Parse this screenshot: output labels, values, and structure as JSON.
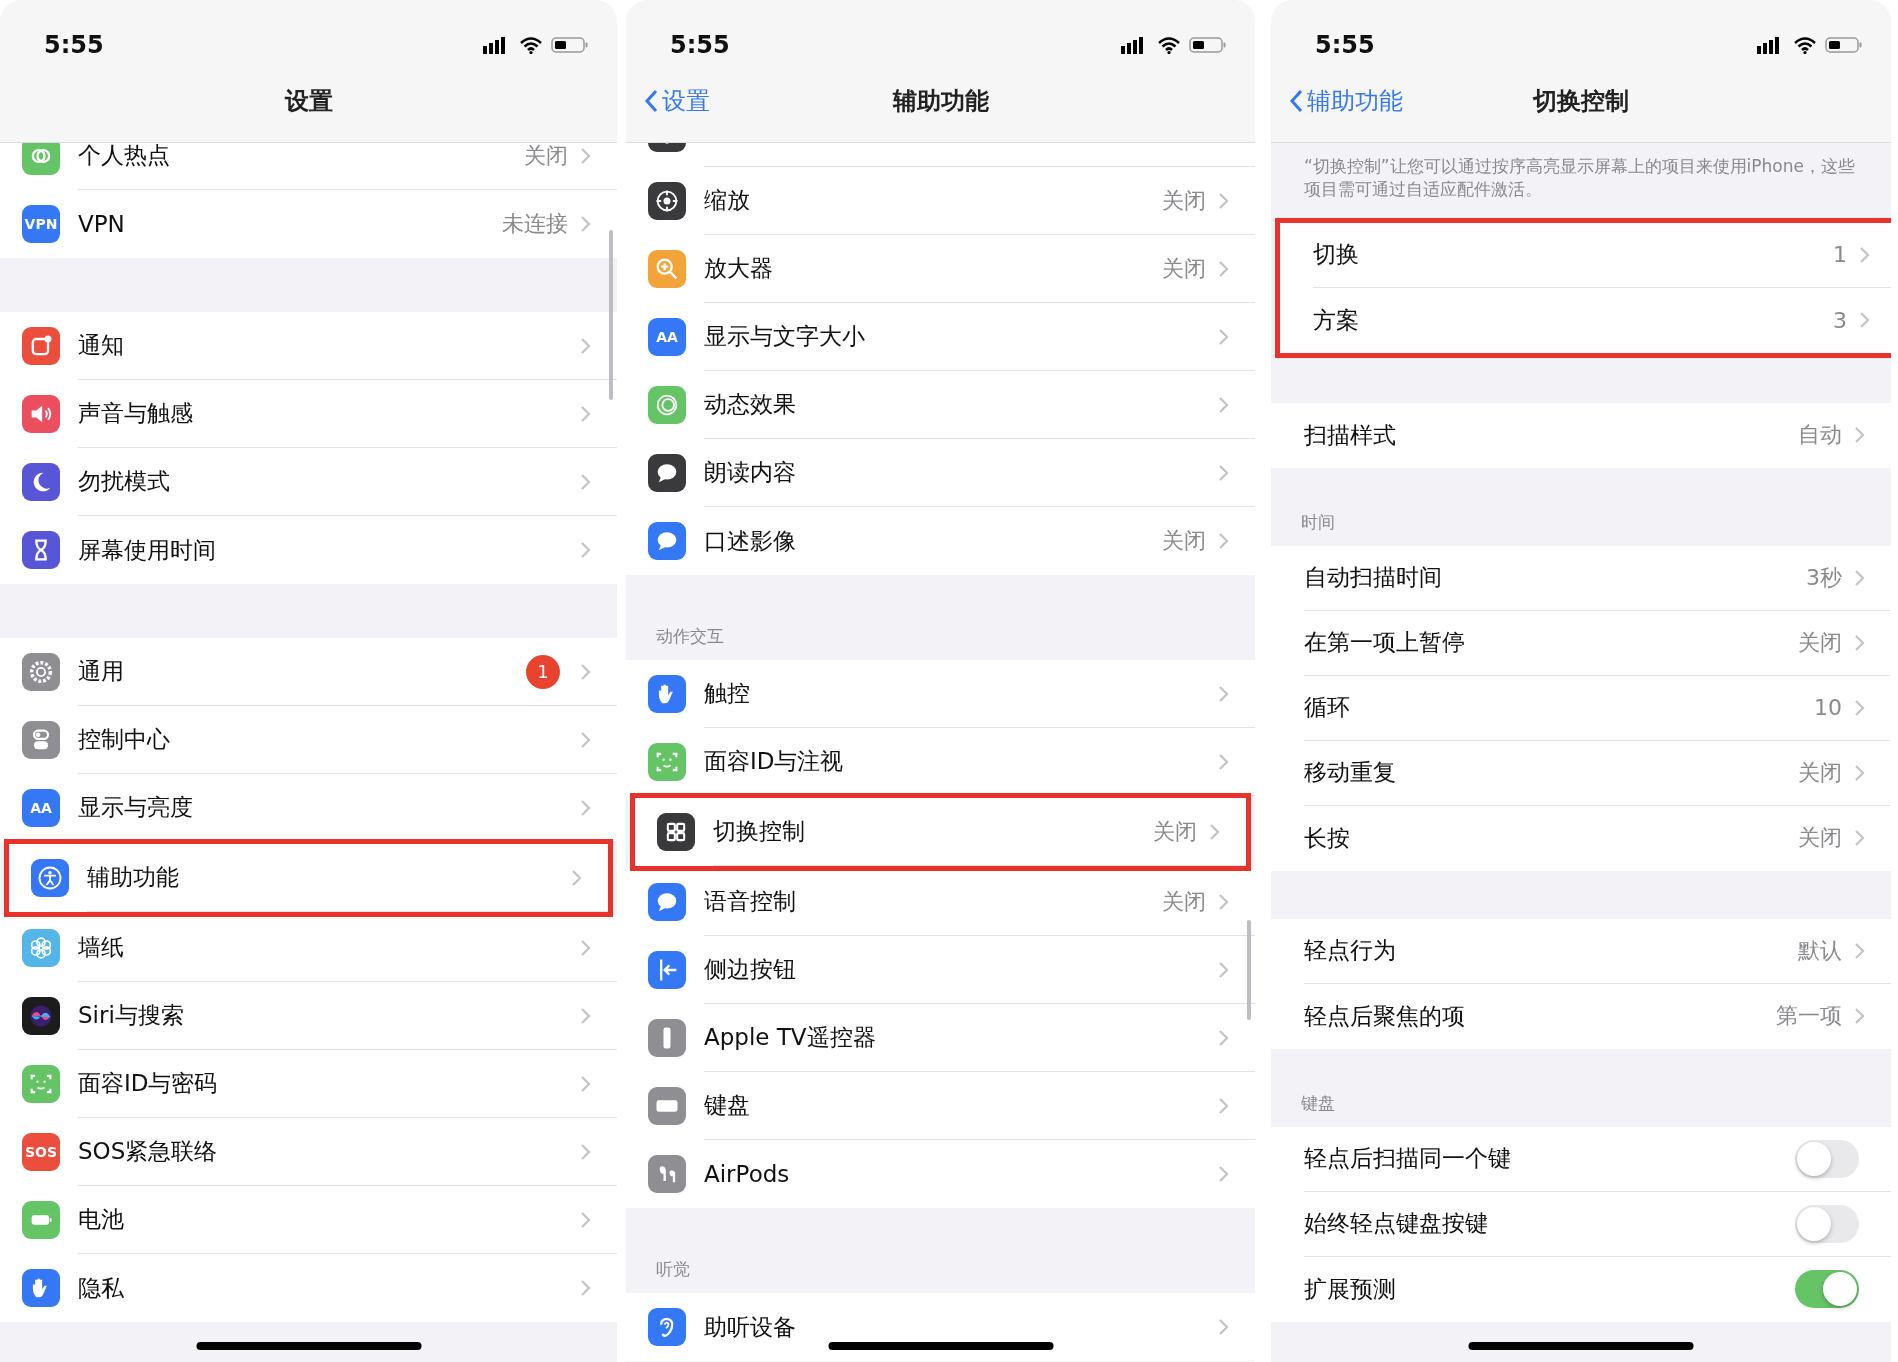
{
  "panels": [
    {
      "time": "5:55",
      "nav": {
        "title": "设置"
      },
      "sections": [
        {
          "rows": [
            {
              "label": "个人热点",
              "value": "关闭",
              "color": "#65c466",
              "kind": "link",
              "highlighted": false
            },
            {
              "label": "VPN",
              "value": "未连接",
              "color": "#3478f6",
              "icon_text": "VPN",
              "kind": "link",
              "highlighted": false
            }
          ]
        },
        {
          "rows": [
            {
              "label": "通知",
              "color": "#eb4e3d",
              "kind": "link",
              "highlighted": false
            },
            {
              "label": "声音与触感",
              "color": "#eb4e5f",
              "kind": "link",
              "highlighted": false
            },
            {
              "label": "勿扰模式",
              "color": "#5856d6",
              "kind": "link",
              "highlighted": false
            },
            {
              "label": "屏幕使用时间",
              "color": "#5856d6",
              "kind": "link",
              "highlighted": false
            }
          ]
        },
        {
          "rows": [
            {
              "label": "通用",
              "badge": "1",
              "color": "#8e8e93",
              "kind": "link",
              "highlighted": false
            },
            {
              "label": "控制中心",
              "color": "#8e8e93",
              "kind": "link",
              "highlighted": false
            },
            {
              "label": "显示与亮度",
              "color": "#3478f6",
              "icon_text": "AA",
              "kind": "link",
              "highlighted": false
            },
            {
              "label": "辅助功能",
              "color": "#3478f6",
              "kind": "link",
              "highlighted": true
            },
            {
              "label": "墙纸",
              "color": "#54b5e8",
              "kind": "link",
              "highlighted": false
            },
            {
              "label": "Siri与搜索",
              "color": "#1c1c1e",
              "kind": "link",
              "highlighted": false
            },
            {
              "label": "面容ID与密码",
              "color": "#65c466",
              "kind": "link",
              "highlighted": false
            },
            {
              "label": "SOS紧急联络",
              "color": "#eb4e3d",
              "icon_text": "SOS",
              "kind": "link",
              "highlighted": false
            },
            {
              "label": "电池",
              "color": "#65c466",
              "kind": "link",
              "highlighted": false
            },
            {
              "label": "隐私",
              "color": "#3478f6",
              "kind": "link",
              "highlighted": false
            }
          ]
        }
      ]
    },
    {
      "time": "5:55",
      "nav": {
        "back": "设置",
        "title": "辅助功能"
      },
      "sections": [
        {
          "rows": [
            {
              "color": "#3a3a3c",
              "kind": "link",
              "highlighted": false
            },
            {
              "label": "缩放",
              "value": "关闭",
              "color": "#3a3a3c",
              "kind": "link",
              "highlighted": false
            },
            {
              "label": "放大器",
              "value": "关闭",
              "color": "#f2a33a",
              "kind": "link",
              "highlighted": false
            },
            {
              "label": "显示与文字大小",
              "color": "#3478f6",
              "icon_text": "AA",
              "kind": "link",
              "highlighted": false
            },
            {
              "label": "动态效果",
              "color": "#65c466",
              "kind": "link",
              "highlighted": false
            },
            {
              "label": "朗读内容",
              "color": "#3a3a3c",
              "kind": "link",
              "highlighted": false
            },
            {
              "label": "口述影像",
              "value": "关闭",
              "color": "#3478f6",
              "kind": "link",
              "highlighted": false
            }
          ]
        },
        {
          "header": "动作交互",
          "rows": [
            {
              "label": "触控",
              "color": "#3478f6",
              "kind": "link",
              "highlighted": false
            },
            {
              "label": "面容ID与注视",
              "color": "#65c466",
              "kind": "link",
              "highlighted": false
            },
            {
              "label": "切换控制",
              "value": "关闭",
              "color": "#3a3a3c",
              "kind": "link",
              "highlighted": true
            },
            {
              "label": "语音控制",
              "value": "关闭",
              "color": "#3478f6",
              "kind": "link",
              "highlighted": false
            },
            {
              "label": "侧边按钮",
              "color": "#3478f6",
              "kind": "link",
              "highlighted": false
            },
            {
              "label": "Apple TV遥控器",
              "color": "#8e8e93",
              "kind": "link",
              "highlighted": false
            },
            {
              "label": "键盘",
              "color": "#8e8e93",
              "kind": "link",
              "highlighted": false
            },
            {
              "label": "AirPods",
              "color": "#8e8e93",
              "kind": "link",
              "highlighted": false
            }
          ]
        },
        {
          "header": "听觉",
          "rows": [
            {
              "label": "助听设备",
              "color": "#3478f6",
              "kind": "link",
              "highlighted": false
            }
          ]
        }
      ]
    },
    {
      "time": "5:55",
      "nav": {
        "back": "辅助功能",
        "title": "切换控制"
      },
      "description": "“切换控制”让您可以通过按序高亮显示屏幕上的项目来使用iPhone，这些项目需可通过自适应配件激活。",
      "sections": [
        {
          "rows": [
            {
              "label": "切换",
              "value": "1",
              "kind": "link",
              "highlighted": true
            },
            {
              "label": "方案",
              "value": "3",
              "kind": "link",
              "highlighted": true
            }
          ]
        },
        {
          "rows": [
            {
              "label": "扫描样式",
              "value": "自动",
              "kind": "link",
              "highlighted": false
            }
          ]
        },
        {
          "header": "时间",
          "rows": [
            {
              "label": "自动扫描时间",
              "value": "3秒",
              "kind": "link",
              "highlighted": false
            },
            {
              "label": "在第一项上暂停",
              "value": "关闭",
              "kind": "link",
              "highlighted": false
            },
            {
              "label": "循环",
              "value": "10",
              "kind": "link",
              "highlighted": false
            },
            {
              "label": "移动重复",
              "value": "关闭",
              "kind": "link",
              "highlighted": false
            },
            {
              "label": "长按",
              "value": "关闭",
              "kind": "link",
              "highlighted": false
            }
          ]
        },
        {
          "rows": [
            {
              "label": "轻点行为",
              "value": "默认",
              "kind": "link",
              "highlighted": false
            },
            {
              "label": "轻点后聚焦的项",
              "value": "第一项",
              "kind": "link",
              "highlighted": false
            }
          ]
        },
        {
          "header": "键盘",
          "rows": [
            {
              "label": "轻点后扫描同一个键",
              "kind": "toggle",
              "on": false,
              "highlighted": false
            },
            {
              "label": "始终轻点键盘按键",
              "kind": "toggle",
              "on": false,
              "highlighted": false
            },
            {
              "label": "扩展预测",
              "kind": "toggle",
              "on": true,
              "highlighted": false
            }
          ]
        }
      ]
    }
  ]
}
